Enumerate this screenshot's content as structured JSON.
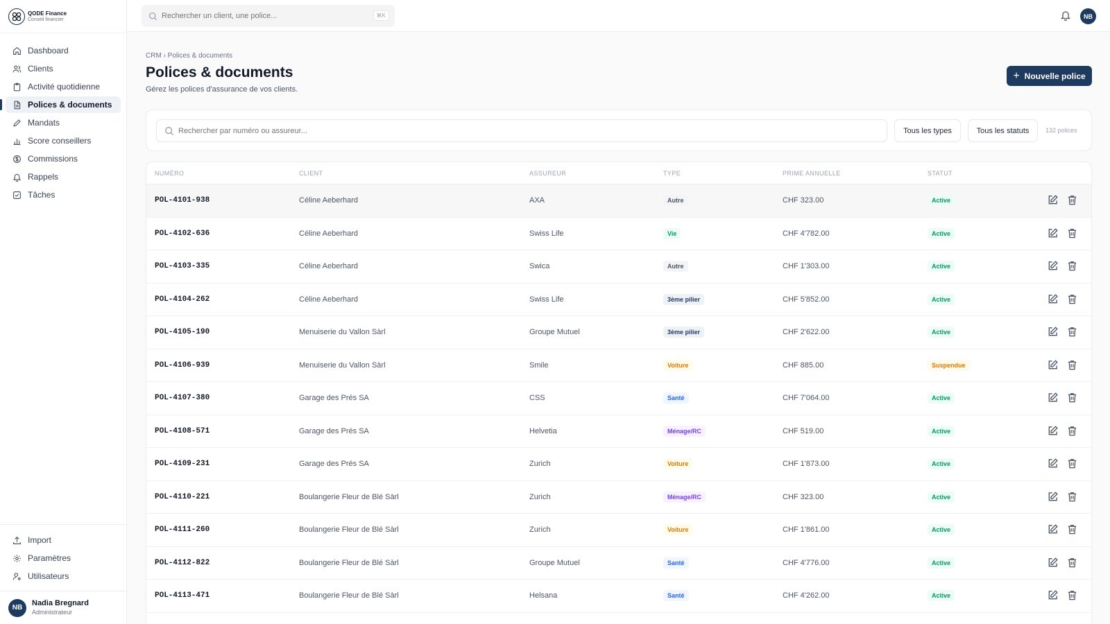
{
  "brand": {
    "name": "QODE Finance",
    "sub": "Conseil financier"
  },
  "sidebar": {
    "items": [
      {
        "label": "Dashboard",
        "icon": "home-icon"
      },
      {
        "label": "Clients",
        "icon": "users-icon"
      },
      {
        "label": "Activité quotidienne",
        "icon": "clipboard-icon"
      },
      {
        "label": "Polices & documents",
        "icon": "file-icon",
        "active": true
      },
      {
        "label": "Mandats",
        "icon": "pen-icon"
      },
      {
        "label": "Score conseillers",
        "icon": "bar-chart-icon"
      },
      {
        "label": "Commissions",
        "icon": "dollar-icon"
      },
      {
        "label": "Rappels",
        "icon": "bell-icon"
      },
      {
        "label": "Tâches",
        "icon": "check-square-icon"
      }
    ],
    "bottom_items": [
      {
        "label": "Import",
        "icon": "upload-icon"
      },
      {
        "label": "Paramètres",
        "icon": "gear-icon"
      },
      {
        "label": "Utilisateurs",
        "icon": "user-cog-icon"
      }
    ],
    "user": {
      "initials": "NB",
      "name": "Nadia Bregnard",
      "role": "Administrateur"
    }
  },
  "topbar": {
    "search_placeholder": "Rechercher un client, une police...",
    "shortcut": "⌘K",
    "avatar_initials": "NB"
  },
  "main": {
    "breadcrumb": "CRM › Polices & documents",
    "title": "Polices & documents",
    "subtitle": "Gérez les polices d'assurance de vos clients.",
    "new_button": "Nouvelle police",
    "filter_placeholder": "Rechercher par numéro ou assureur...",
    "filter_types": "Tous les types",
    "filter_status": "Tous les statuts",
    "count": "132 polices"
  },
  "table": {
    "headers": [
      "Numéro",
      "Client",
      "Assureur",
      "Type",
      "Prime annuelle",
      "Statut"
    ],
    "rows": [
      {
        "num": "POL-4101-938",
        "client": "Céline Aeberhard",
        "ins": "AXA",
        "type": "Autre",
        "prime": "CHF 323.00",
        "status": "Active"
      },
      {
        "num": "POL-4102-636",
        "client": "Céline Aeberhard",
        "ins": "Swiss Life",
        "type": "Vie",
        "prime": "CHF 4'782.00",
        "status": "Active"
      },
      {
        "num": "POL-4103-335",
        "client": "Céline Aeberhard",
        "ins": "Swica",
        "type": "Autre",
        "prime": "CHF 1'303.00",
        "status": "Active"
      },
      {
        "num": "POL-4104-262",
        "client": "Céline Aeberhard",
        "ins": "Swiss Life",
        "type": "3ème pilier",
        "prime": "CHF 5'852.00",
        "status": "Active"
      },
      {
        "num": "POL-4105-190",
        "client": "Menuiserie du Vallon Sàrl",
        "ins": "Groupe Mutuel",
        "type": "3ème pilier",
        "prime": "CHF 2'622.00",
        "status": "Active"
      },
      {
        "num": "POL-4106-939",
        "client": "Menuiserie du Vallon Sàrl",
        "ins": "Smile",
        "type": "Voiture",
        "prime": "CHF 885.00",
        "status": "Suspendue"
      },
      {
        "num": "POL-4107-380",
        "client": "Garage des Prés SA",
        "ins": "CSS",
        "type": "Santé",
        "prime": "CHF 7'064.00",
        "status": "Active"
      },
      {
        "num": "POL-4108-571",
        "client": "Garage des Prés SA",
        "ins": "Helvetia",
        "type": "Ménage/RC",
        "prime": "CHF 519.00",
        "status": "Active"
      },
      {
        "num": "POL-4109-231",
        "client": "Garage des Prés SA",
        "ins": "Zurich",
        "type": "Voiture",
        "prime": "CHF 1'873.00",
        "status": "Active"
      },
      {
        "num": "POL-4110-221",
        "client": "Boulangerie Fleur de Blé Sàrl",
        "ins": "Zurich",
        "type": "Ménage/RC",
        "prime": "CHF 323.00",
        "status": "Active"
      },
      {
        "num": "POL-4111-260",
        "client": "Boulangerie Fleur de Blé Sàrl",
        "ins": "Zurich",
        "type": "Voiture",
        "prime": "CHF 1'861.00",
        "status": "Active"
      },
      {
        "num": "POL-4112-822",
        "client": "Boulangerie Fleur de Blé Sàrl",
        "ins": "Groupe Mutuel",
        "type": "Santé",
        "prime": "CHF 4'776.00",
        "status": "Active"
      },
      {
        "num": "POL-4113-471",
        "client": "Boulangerie Fleur de Blé Sàrl",
        "ins": "Helsana",
        "type": "Santé",
        "prime": "CHF 4'262.00",
        "status": "Active"
      }
    ]
  },
  "colors": {
    "accent": "#1e3a5f",
    "type_badges": {
      "Autre": {
        "bg": "#f3f4f6",
        "fg": "#4b5563"
      },
      "Vie": {
        "bg": "#ecfdf5",
        "fg": "#059669"
      },
      "3ème pilier": {
        "bg": "#eef2f7",
        "fg": "#1e3a5f"
      },
      "Voiture": {
        "bg": "#fffbeb",
        "fg": "#d97706"
      },
      "Santé": {
        "bg": "#eff6ff",
        "fg": "#2563eb"
      },
      "Ménage/RC": {
        "bg": "#f5f3ff",
        "fg": "#7c3aed"
      }
    },
    "status_badges": {
      "Active": {
        "bg": "#ecfdf5",
        "fg": "#059669"
      },
      "Suspendue": {
        "bg": "#fffbeb",
        "fg": "#d97706"
      }
    }
  }
}
